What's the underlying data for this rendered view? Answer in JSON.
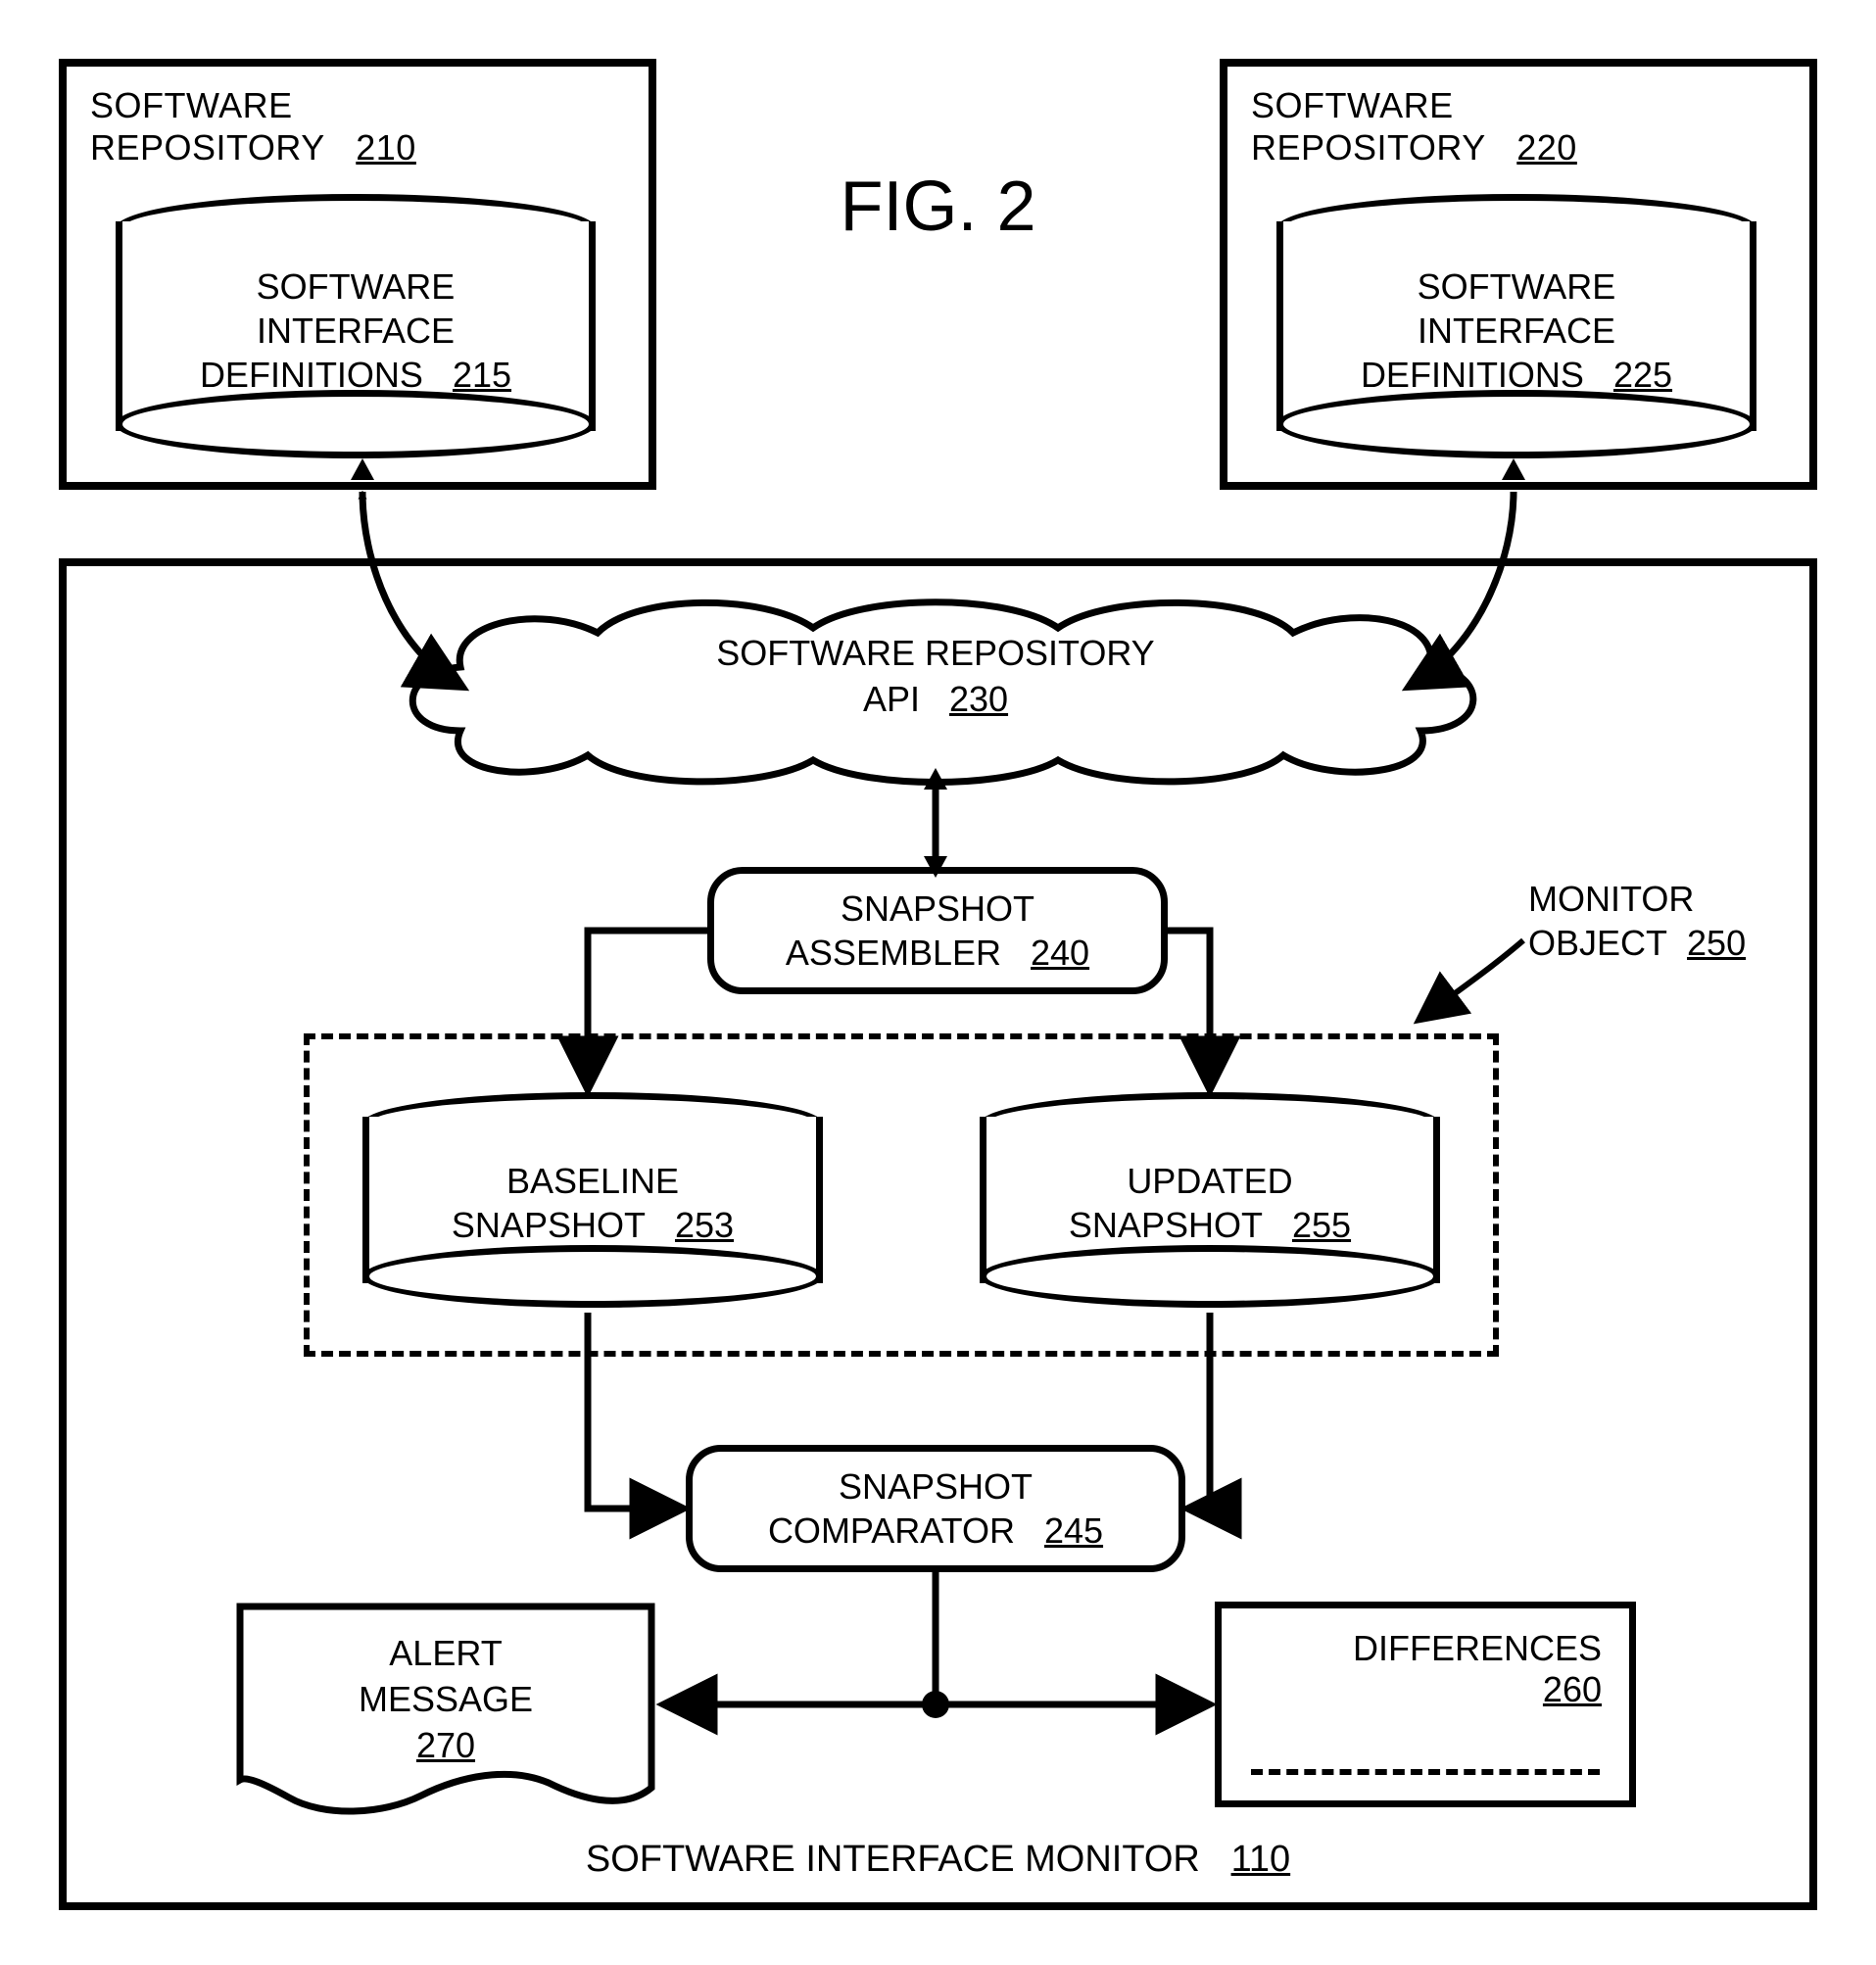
{
  "figure_title": "FIG. 2",
  "repo_left": {
    "title_l1": "SOFTWARE",
    "title_l2": "REPOSITORY",
    "ref": "210",
    "cyl_l1": "SOFTWARE",
    "cyl_l2": "INTERFACE",
    "cyl_l3": "DEFINITIONS",
    "cyl_ref": "215"
  },
  "repo_right": {
    "title_l1": "SOFTWARE",
    "title_l2": "REPOSITORY",
    "ref": "220",
    "cyl_l1": "SOFTWARE",
    "cyl_l2": "INTERFACE",
    "cyl_l3": "DEFINITIONS",
    "cyl_ref": "225"
  },
  "cloud": {
    "l1": "SOFTWARE REPOSITORY",
    "l2": "API",
    "ref": "230"
  },
  "assembler": {
    "l1": "SNAPSHOT",
    "l2": "ASSEMBLER",
    "ref": "240"
  },
  "monitor_object": {
    "l1": "MONITOR",
    "l2": "OBJECT",
    "ref": "250"
  },
  "baseline": {
    "l1": "BASELINE",
    "l2": "SNAPSHOT",
    "ref": "253"
  },
  "updated": {
    "l1": "UPDATED",
    "l2": "SNAPSHOT",
    "ref": "255"
  },
  "comparator": {
    "l1": "SNAPSHOT",
    "l2": "COMPARATOR",
    "ref": "245"
  },
  "alert": {
    "l1": "ALERT",
    "l2": "MESSAGE",
    "ref": "270"
  },
  "differences": {
    "label": "DIFFERENCES",
    "ref": "260"
  },
  "monitor_title": {
    "label": "SOFTWARE INTERFACE MONITOR",
    "ref": "110"
  }
}
